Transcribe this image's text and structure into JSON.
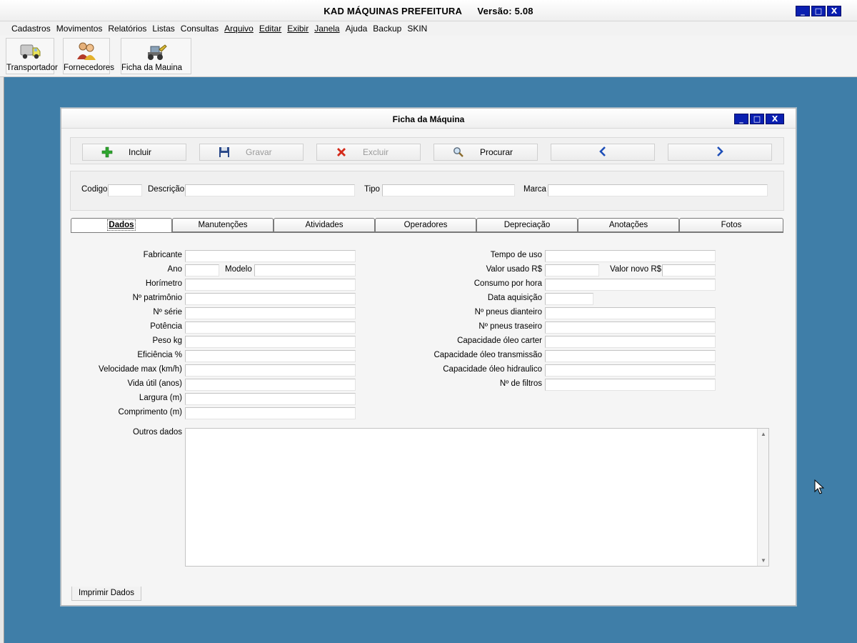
{
  "app": {
    "title": "KAD MÁQUINAS PREFEITURA",
    "version": "Versão: 5.08"
  },
  "menu": [
    "Cadastros",
    "Movimentos",
    "Relatórios",
    "Listas",
    "Consultas",
    "Arquivo",
    "Editar",
    "Exibir",
    "Janela",
    "Ajuda",
    "Backup",
    "SKIN"
  ],
  "toolbar": {
    "transportador": "Transportador",
    "fornecedores": "Fornecedores",
    "ficha": "Ficha da Mauina"
  },
  "window": {
    "title": "Ficha da Máquina"
  },
  "actions": {
    "incluir": "Incluir",
    "gravar": "Gravar",
    "excluir": "Excluir",
    "procurar": "Procurar"
  },
  "header_fields": {
    "codigo": "Codigo",
    "descricao": "Descrição",
    "tipo": "Tipo",
    "marca": "Marca"
  },
  "tabs": [
    "Dados",
    "Manutenções",
    "Atividades",
    "Operadores",
    "Depreciação",
    "Anotações",
    "Fotos"
  ],
  "dados_left": {
    "fabricante": "Fabricante",
    "ano": "Ano",
    "modelo": "Modelo",
    "horimetro": "Horímetro",
    "patrimonio": "Nº patrimônio",
    "serie": "Nº série",
    "potencia": "Potência",
    "peso": "Peso kg",
    "eficiencia": "Eficiência %",
    "velocidade": "Velocidade max (km/h)",
    "vida_util": "Vida útil (anos)",
    "largura": "Largura (m)",
    "comprimento": "Comprimento (m)"
  },
  "dados_right": {
    "tempo_uso": "Tempo de uso",
    "valor_usado": "Valor usado R$",
    "valor_novo": "Valor novo R$",
    "consumo": "Consumo por hora",
    "data_aquisicao": "Data aquisição",
    "pneus_dianteiro": "Nº pneus dianteiro",
    "pneus_traseiro": "Nº pneus traseiro",
    "oleo_carter": "Capacidade óleo carter",
    "oleo_transmissao": "Capacidade óleo transmissão",
    "oleo_hidraulico": "Capacidade óleo hidraulico",
    "filtros": "Nº de filtros"
  },
  "outros_dados": "Outros dados",
  "print_tab": "Imprimir Dados",
  "colors": {
    "desktop": "#3f7ea8",
    "window_buttons": "#0a1fb0",
    "incluir_icon": "#2fa62f",
    "excluir_icon": "#d42a1a",
    "nav_arrow": "#1e4fb8"
  }
}
